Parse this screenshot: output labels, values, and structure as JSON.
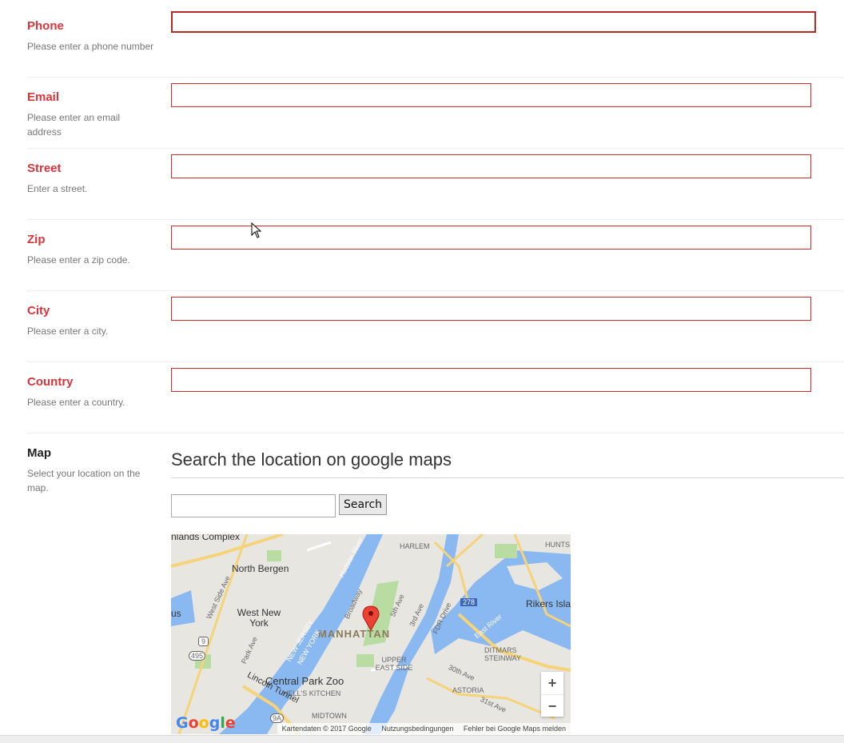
{
  "fields": [
    {
      "key": "phone",
      "label": "Phone",
      "help": "Please enter a phone number",
      "value": ""
    },
    {
      "key": "email",
      "label": "Email",
      "help": "Please enter an email address",
      "value": ""
    },
    {
      "key": "street",
      "label": "Street",
      "help": "Enter a street.",
      "value": ""
    },
    {
      "key": "zip",
      "label": "Zip",
      "help": "Please enter a zip code.",
      "value": ""
    },
    {
      "key": "city",
      "label": "City",
      "help": "Please enter a city.",
      "value": ""
    },
    {
      "key": "country",
      "label": "Country",
      "help": "Please enter a country.",
      "value": ""
    }
  ],
  "map_section": {
    "label": "Map",
    "help": "Select your location on the map.",
    "title": "Search the location on google maps",
    "search_value": "",
    "search_button": "Search",
    "labels": {
      "manhattan": "MANHATTAN",
      "north_bergen": "North Bergen",
      "west_new_york": "West New York",
      "central_park_zoo": "Central Park Zoo",
      "hells_kitchen": "HELL'S KITCHEN",
      "harlem": "HARLEM",
      "upper_east_side": "UPPER EAST SIDE",
      "rikers": "Rikers Isla",
      "ditmars": "DITMARS STEINWAY",
      "astoria": "ASTORIA",
      "midtown": "MIDTOWN",
      "lincoln_tunnel": "Lincoln Tunnel",
      "new_jersey": "NEW JERSEY",
      "new_york": "NEW YORK",
      "hunts": "HUNTS",
      "complex": "nlands Complex",
      "us": "us",
      "hudson_river": "Hudson River",
      "fdr": "FDR Drive",
      "east_river": "East River",
      "broadway": "Broadway",
      "park_ave": "Park Ave",
      "west_side": "West Side Ave",
      "ave_5th": "5th Ave",
      "ave_3rd": "3rd Ave",
      "ave_30th": "30th Ave",
      "ave_31st": "31st Ave",
      "shield_9": "9",
      "shield_495": "495",
      "shield_9a": "9A",
      "shield_278": "278"
    },
    "zoom_in": "+",
    "zoom_out": "−",
    "google_logo": "Google",
    "attribution": [
      "Kartendaten © 2017 Google",
      "Nutzungsbedingungen",
      "Fehler bei Google Maps melden"
    ]
  },
  "colors": {
    "error_red": "#d9343a",
    "water": "#8ab8f0",
    "park": "#b9dca3",
    "road": "#f5d37a"
  }
}
